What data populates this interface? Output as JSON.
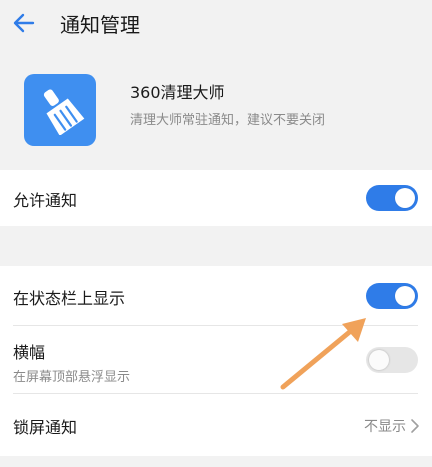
{
  "header": {
    "title": "通知管理"
  },
  "app": {
    "name": "360清理大师",
    "description": "清理大师常驻通知，建议不要关闭"
  },
  "settings": {
    "allow_notifications": {
      "label": "允许通知",
      "enabled": true
    },
    "status_bar": {
      "label": "在状态栏上显示",
      "enabled": true
    },
    "banner": {
      "label": "横幅",
      "sublabel": "在屏幕顶部悬浮显示",
      "enabled": false
    },
    "lock_screen": {
      "label": "锁屏通知",
      "value": "不显示"
    }
  },
  "colors": {
    "accent": "#2f7ce8",
    "app_icon": "#3f8ff0",
    "annotation_arrow": "#f0a25a"
  },
  "icons": {
    "back": "arrow-left",
    "app": "broom",
    "chevron": "chevron-right"
  }
}
